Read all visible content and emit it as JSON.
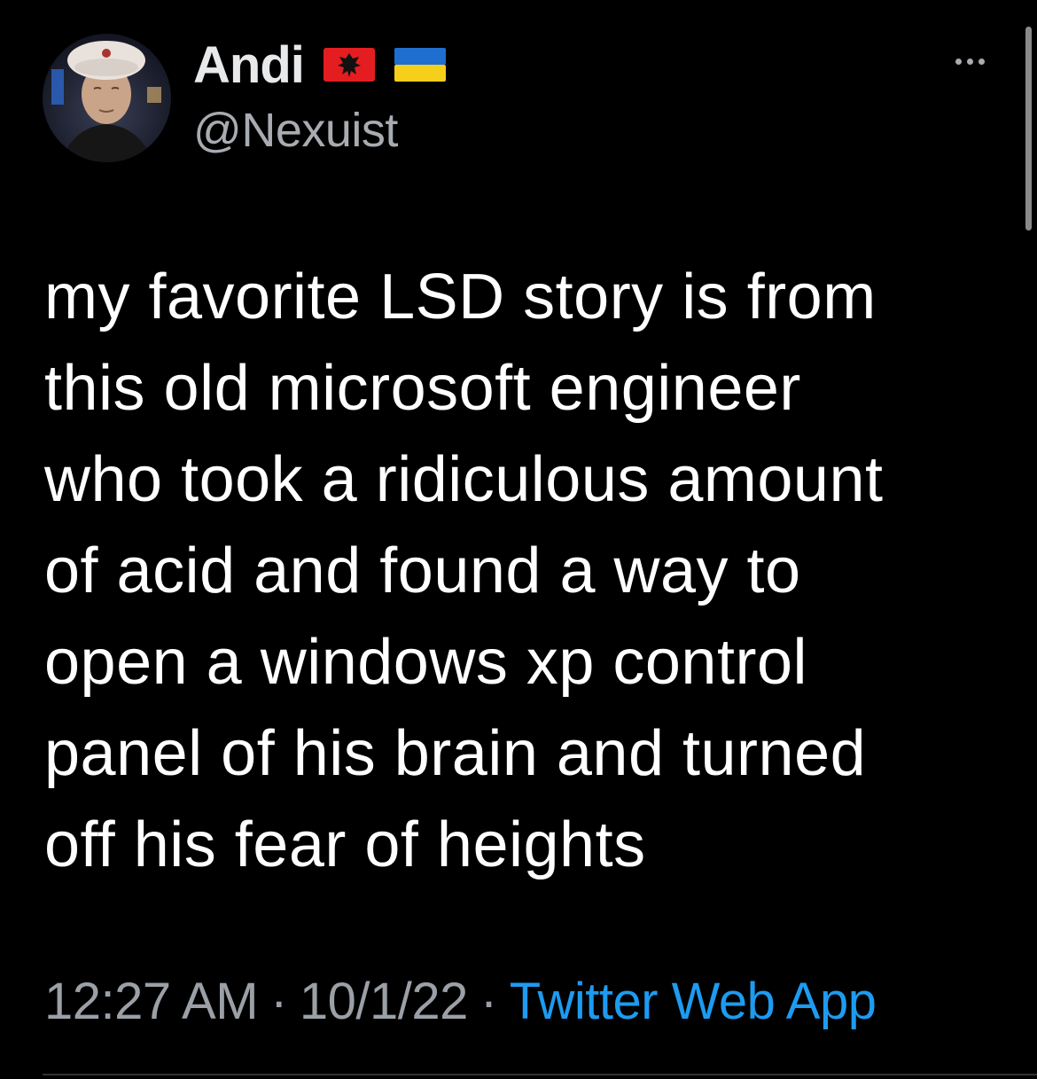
{
  "tweet": {
    "author": {
      "display_name": "Andi",
      "handle": "@Nexuist",
      "flags": [
        "albania-flag",
        "ukraine-flag"
      ],
      "avatar": "avatar-photo"
    },
    "more_icon": "ellipsis-icon",
    "text_lines": [
      "my favorite LSD story is from",
      "this old microsoft engineer",
      "who took a ridiculous amount",
      "of acid and found a way to",
      "open a windows xp control",
      "panel of his brain and turned",
      "off his fear of heights"
    ],
    "meta": {
      "time": "12:27 AM",
      "date": "10/1/22",
      "separator": "·",
      "source": "Twitter Web App"
    }
  },
  "colors": {
    "background": "#000000",
    "text": "#ffffff",
    "secondary_text": "#9aa0a6",
    "link": "#1d9bf0",
    "divider": "#2f3336"
  }
}
